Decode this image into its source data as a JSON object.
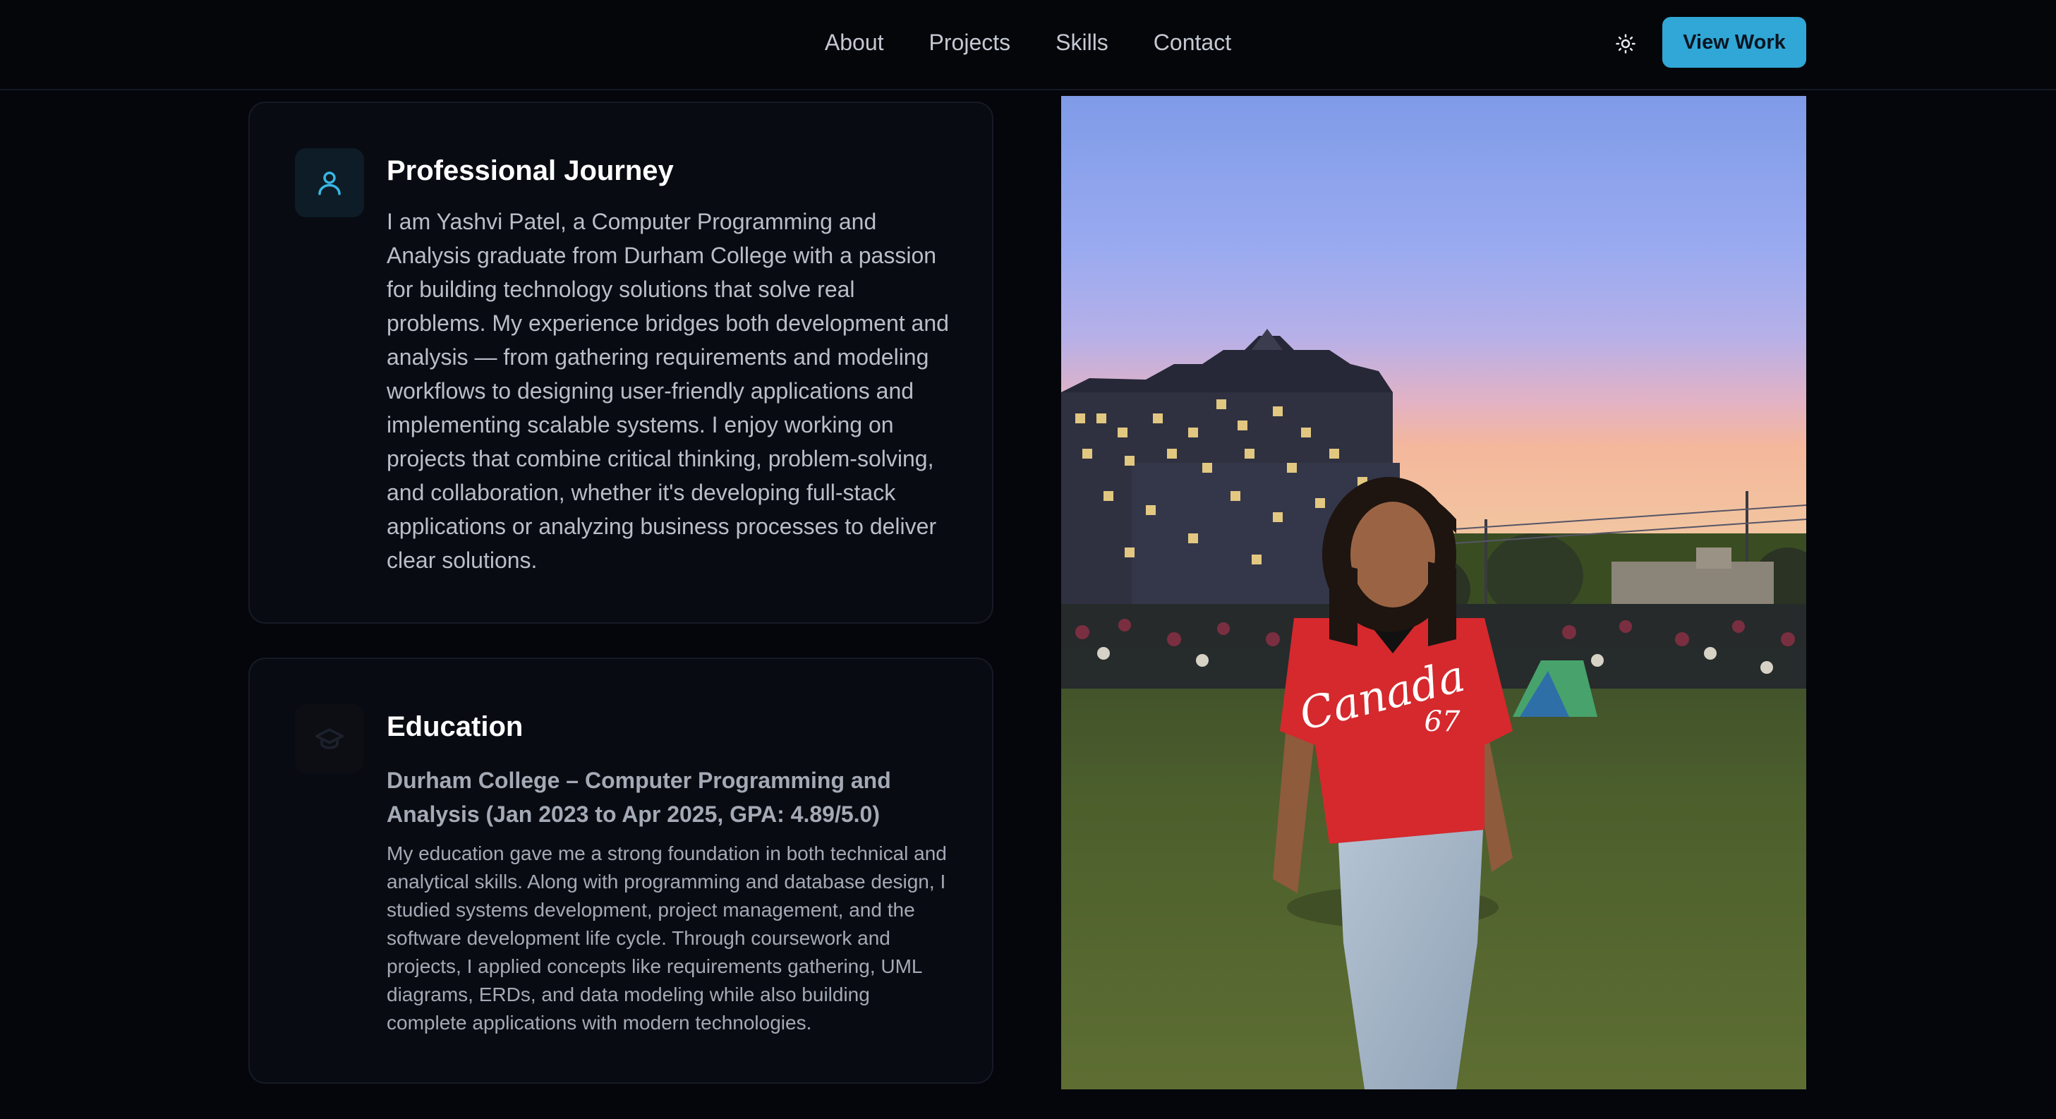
{
  "nav": {
    "links": [
      "About",
      "Projects",
      "Skills",
      "Contact"
    ],
    "theme_toggle_icon": "sun-icon",
    "cta_label": "View Work"
  },
  "journey": {
    "icon": "user-icon",
    "title": "Professional Journey",
    "text": "I am Yashvi Patel, a Computer Programming and Analysis graduate from Durham College with a passion for building technology solutions that solve real problems. My experience bridges both development and analysis — from gathering requirements and modeling workflows to designing user-friendly applications and implementing scalable systems. I enjoy working on projects that combine critical thinking, problem-solving, and collaboration, whether it's developing full-stack applications or analyzing business processes to deliver clear solutions."
  },
  "education": {
    "icon": "graduation-cap-icon",
    "title": "Education",
    "subtitle": "Durham College – Computer Programming and Analysis (Jan 2023 to Apr 2025, GPA: 4.89/5.0)",
    "text": "My education gave me a strong foundation in both technical and analytical skills. Along with programming and database design, I studied systems development, project management, and the software development life cycle. Through coursework and projects, I applied concepts like requirements gathering, UML diagrams, ERDs, and data modeling while also building complete applications with modern technologies."
  },
  "photo": {
    "jersey_text": "Canada",
    "jersey_number": "67"
  },
  "colors": {
    "accent": "#30a7d6",
    "background": "#05060b",
    "card": "#090b12"
  }
}
